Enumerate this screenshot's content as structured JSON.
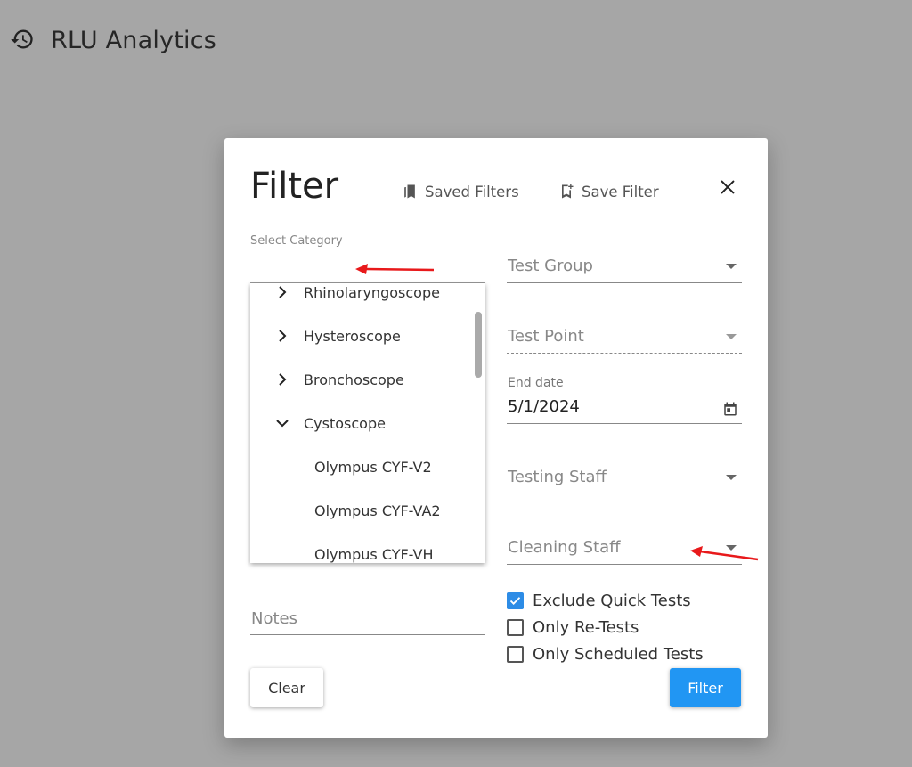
{
  "app": {
    "title": "RLU Analytics",
    "icon": "history-icon"
  },
  "dialog": {
    "title": "Filter",
    "saved_filters_label": "Saved Filters",
    "save_filter_label": "Save Filter",
    "close_icon": "close-icon"
  },
  "category": {
    "label": "Select Category",
    "tree": [
      {
        "label": "Rhinolaryngoscope",
        "expanded": false,
        "child": false
      },
      {
        "label": "Hysteroscope",
        "expanded": false,
        "child": false
      },
      {
        "label": "Bronchoscope",
        "expanded": false,
        "child": false
      },
      {
        "label": "Cystoscope",
        "expanded": true,
        "child": false
      },
      {
        "label": "Olympus CYF-V2",
        "child": true
      },
      {
        "label": "Olympus CYF-VA2",
        "child": true
      },
      {
        "label": "Olympus CYF-VH",
        "child": true
      }
    ]
  },
  "fields": {
    "test_group": {
      "placeholder": "Test Group"
    },
    "test_point": {
      "placeholder": "Test Point"
    },
    "end_date": {
      "label": "End date",
      "value": "5/1/2024"
    },
    "testing_staff": {
      "placeholder": "Testing Staff"
    },
    "cleaning_staff": {
      "placeholder": "Cleaning Staff"
    },
    "notes": {
      "placeholder": "Notes"
    }
  },
  "checkboxes": [
    {
      "label": "Exclude Quick Tests",
      "checked": true
    },
    {
      "label": "Only Re-Tests",
      "checked": false
    },
    {
      "label": "Only Scheduled Tests",
      "checked": false
    }
  ],
  "buttons": {
    "clear": "Clear",
    "filter": "Filter"
  },
  "colors": {
    "accent": "#2196f3",
    "annotation_arrow": "#e8191b"
  }
}
